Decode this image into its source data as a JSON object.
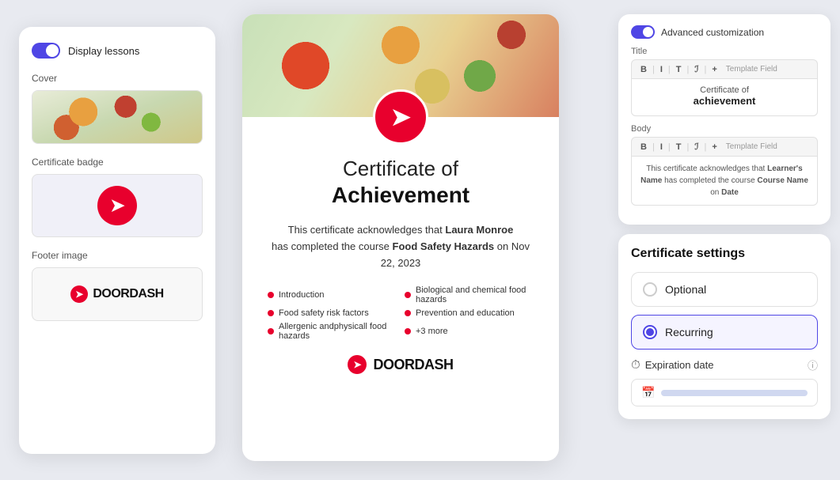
{
  "left": {
    "toggle_label": "Display lessons",
    "cover_label": "Cover",
    "badge_label": "Certificate badge",
    "footer_label": "Footer image",
    "doordash_text": "DOORDASH"
  },
  "center": {
    "title_light": "Certificate of",
    "title_bold": "Achievement",
    "desc": "This certificate acknowledges that",
    "name": "Laura Monroe",
    "completed_text": "has completed the course",
    "course": "Food Safety Hazards",
    "date_text": "on Nov 22, 2023",
    "bullets": [
      "Introduction",
      "Biological and chemical food hazards",
      "Food safety risk factors",
      "Prevention and education",
      "Allergenic andphysicall food hazards",
      "+3 more"
    ],
    "footer_text": "DOORDASH"
  },
  "right_top": {
    "toggle_label": "Advanced customization",
    "title_label": "Title",
    "toolbar_bold": "B",
    "toolbar_italic": "I",
    "toolbar_t": "T₁",
    "toolbar_it": "ℐ",
    "toolbar_plus": "+",
    "toolbar_field": "Template Field",
    "cert_line1": "Certificate of",
    "cert_line2": "achievement",
    "body_label": "Body",
    "body_preview_learner": "Learner's Name",
    "body_preview_course": "Course Name",
    "body_preview_date": "Date",
    "body_preview_text": "This certificate acknowledges that"
  },
  "right_bottom": {
    "title": "Certificate settings",
    "option1_label": "Optional",
    "option2_label": "Recurring",
    "expiry_label": "Expiration date"
  }
}
